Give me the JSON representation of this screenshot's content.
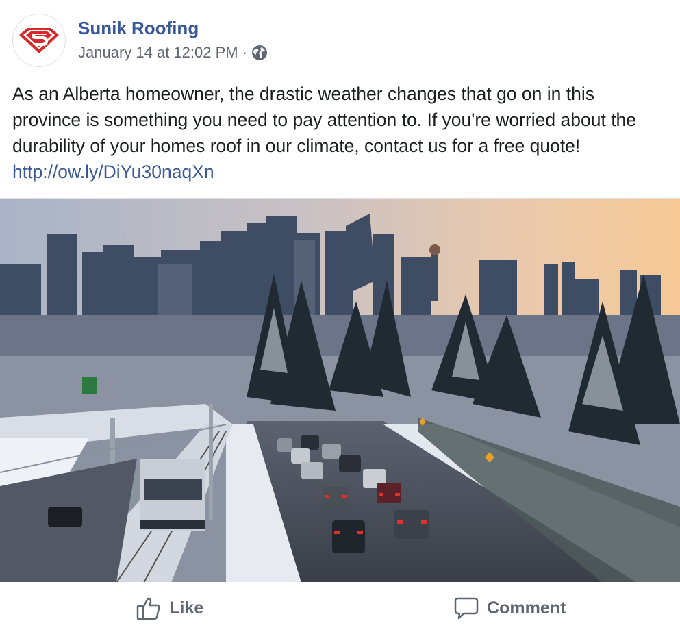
{
  "post": {
    "page_name": "Sunik Roofing",
    "timestamp": "January 14 at 12:02 PM",
    "separator": "·",
    "audience_icon": "globe-icon",
    "body_text": "As an Alberta homeowner, the drastic weather changes that go on in this province is something you need to pay attention to. If you're worried about the durability of your homes roof in our climate, contact us for a free quote!",
    "link_text": "http://ow.ly/DiYu30naqXn",
    "image_icon": "winter-city-highway-photo"
  },
  "actions": {
    "like_label": "Like",
    "like_icon": "thumbs-up-icon",
    "comment_label": "Comment",
    "comment_icon": "comment-bubble-icon"
  },
  "colors": {
    "link": "#385898",
    "text": "#1c1e21",
    "muted": "#606770",
    "logo_red": "#d62a2a"
  }
}
